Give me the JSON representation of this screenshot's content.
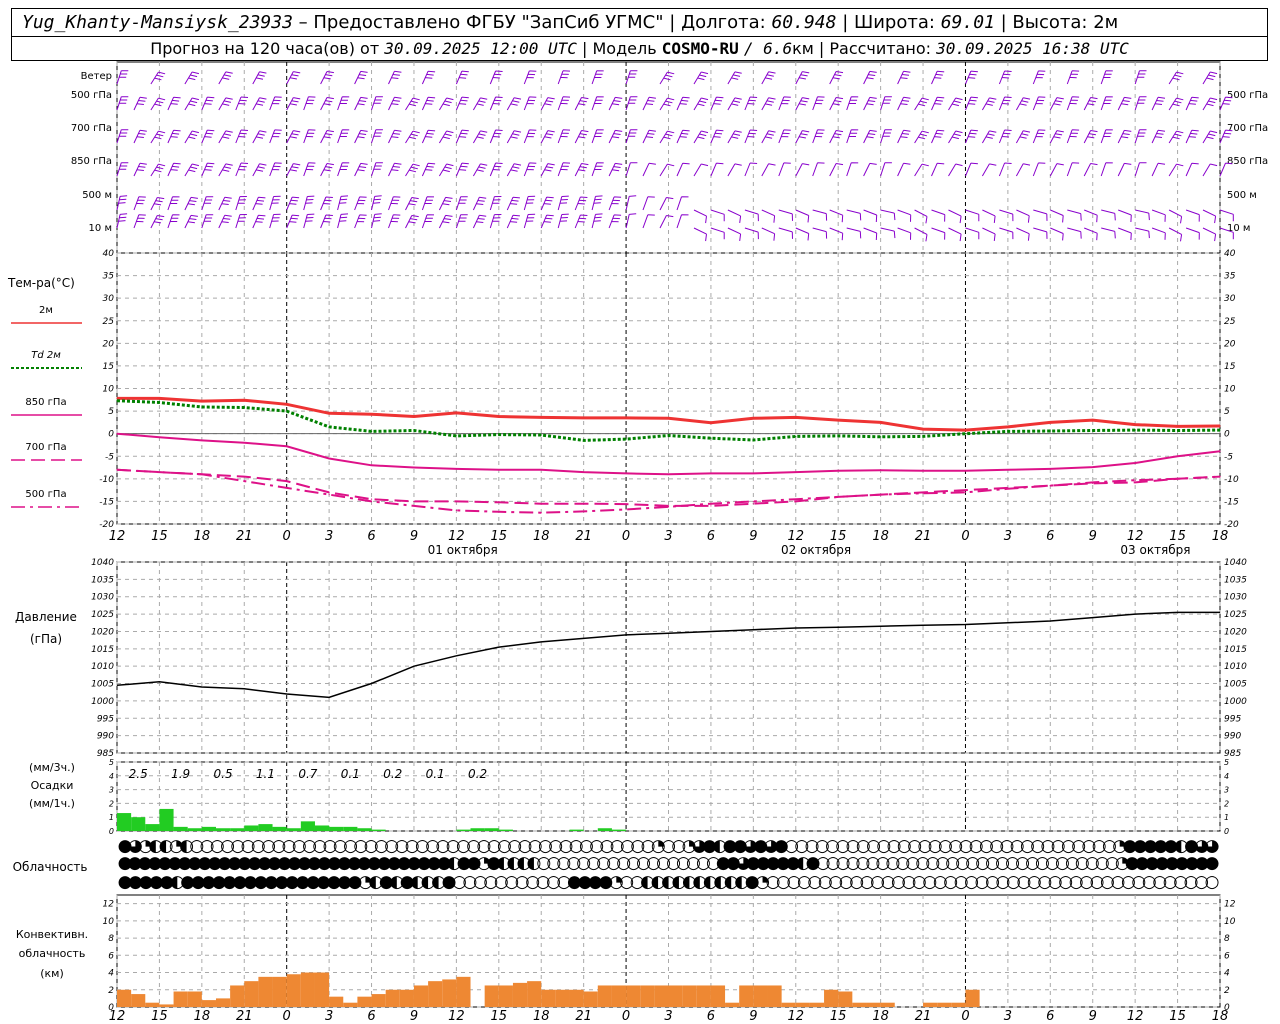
{
  "header": {
    "station": "Yug_Khanty-Mansiysk_23933",
    "provider": "– Предоставлено ФГБУ \"ЗапСиб УГМС\"",
    "lon_label": "| Долгота:",
    "lon_value": "60.948",
    "lat_label": "| Широта:",
    "lat_value": "69.01",
    "alt_label": "| Высота:",
    "alt_value": "2м",
    "forecast_prefix": "Прогноз на 120 часа(ов) от",
    "forecast_time": "30.09.2025 12:00 UTC",
    "model_label": "| Модель",
    "model_name": "COSMO-RU",
    "model_res": "/ 6.6",
    "model_res_unit": "км",
    "calc_label": "| Рассчитано:",
    "calc_time": "30.09.2025 16:38 UTC"
  },
  "wind_panel": {
    "row_labels": [
      "Ветер",
      "500 гПа",
      "700 гПа",
      "850 гПа",
      "500 м",
      "10  м"
    ],
    "right_labels": [
      "500 гПа",
      "700 гПа",
      "850 гПа",
      "500 м",
      "10  м"
    ],
    "barb_color": "#8800cc"
  },
  "temp_panel": {
    "title": "Тем-ра(°С)",
    "legend": [
      {
        "label": "2м",
        "color": "#ee3333",
        "style": "solid"
      },
      {
        "label": "Td  2м",
        "color": "#008000",
        "style": "dotted"
      },
      {
        "label": "850 гПа",
        "color": "#dd1188",
        "style": "solid"
      },
      {
        "label": "700 гПа",
        "color": "#dd1188",
        "style": "dashed"
      },
      {
        "label": "500 гПа",
        "color": "#dd1188",
        "style": "dashdot"
      }
    ]
  },
  "time_axis": {
    "ticks": [
      "12",
      "15",
      "18",
      "21",
      "0",
      "3",
      "6",
      "9",
      "12",
      "15",
      "18",
      "21",
      "0",
      "3",
      "6",
      "9",
      "12",
      "15",
      "18",
      "21",
      "0",
      "3",
      "6",
      "9",
      "12",
      "15",
      "18"
    ],
    "date_labels": [
      "01 октября",
      "02 октября",
      "03 октября"
    ]
  },
  "pressure_panel": {
    "title": "Давление",
    "unit": "(гПа)"
  },
  "precip_panel": {
    "label1": "(мм/3ч.)",
    "label2": "Осадки",
    "label3": "(мм/1ч.)",
    "totals_3h": [
      "2.5",
      "1.9",
      "0.5",
      "1.1",
      "0.7",
      "0.1",
      "0.2",
      "0.1",
      "0.2"
    ],
    "bar_color": "#22cc22"
  },
  "cloud_panel": {
    "label": "Облачность",
    "rows": [
      "●◕◔◐◐◔◐○○○○○○○○○○○○○○○○○○○○○○○○○○○○○○○○○○○○○○○○○○○○○◔○○◔◕●◐●●◕●◕●○○○○○○○○○○○○○○○○○○○○○○○○○○○○○○○○◔●●●●●◐●◕◕",
      "●●●●●●●●●●●●●●●●●●●●●●●●●●●●●●●●●◐●●◔●◐◐◐◐○○○○○○○○○○○○○○○○○○●●◕●●●●●◐●○○○○○○○○○○○○○○○○○○○○○○○○○○○○○○◔●●●●●●●●●",
      "●●●●●◐●●●●●●●●●●●●●●●●●◔◐●◐●◐◐◐●○○○○○○○○○○○●●●●◔○○◐◐◐◐◐◐◐◐◐◐●◔○○○○○○○○○○○○○○○○○○○○○○○○○○○○○○○○○○○○○○○○○○○"
    ]
  },
  "conv_panel": {
    "label1": "Конвективн.",
    "label2": "облачность",
    "label3": "(км)",
    "bar_color": "#ee8833"
  },
  "chart_data": [
    {
      "type": "line",
      "name": "temperature",
      "xlabel": "",
      "ylabel": "Тем-ра(°С)",
      "ylim": [
        -20,
        40
      ],
      "yticks": [
        -20,
        -15,
        -10,
        -5,
        0,
        5,
        10,
        15,
        20,
        25,
        30,
        35,
        40
      ],
      "x_hours": [
        0,
        3,
        6,
        9,
        12,
        15,
        18,
        21,
        24,
        27,
        30,
        33,
        36,
        39,
        42,
        45,
        48,
        51,
        54,
        57,
        60,
        63,
        66,
        69,
        72,
        75,
        78
      ],
      "grid": true,
      "series": [
        {
          "name": "2м",
          "color": "#ee3333",
          "style": "solid",
          "values": [
            7.8,
            7.8,
            7.2,
            7.4,
            6.5,
            4.5,
            4.3,
            3.8,
            4.6,
            3.8,
            3.6,
            3.5,
            3.5,
            3.4,
            2.4,
            3.4,
            3.6,
            3.0,
            2.5,
            1.0,
            0.8,
            1.5,
            2.5,
            3.0,
            2.0,
            1.6,
            1.7
          ]
        },
        {
          "name": "Td  2м",
          "color": "#008000",
          "style": "dotted",
          "values": [
            7.3,
            6.9,
            5.9,
            5.8,
            5.0,
            1.5,
            0.5,
            0.7,
            -0.5,
            -0.2,
            -0.3,
            -1.5,
            -1.2,
            -0.4,
            -1.0,
            -1.4,
            -0.6,
            -0.5,
            -0.7,
            -0.6,
            0.0,
            0.5,
            0.6,
            0.7,
            0.8,
            0.7,
            0.8
          ]
        },
        {
          "name": "850 гПа",
          "color": "#dd1188",
          "style": "solid",
          "values": [
            0.0,
            -0.8,
            -1.5,
            -2.0,
            -2.8,
            -5.5,
            -7.0,
            -7.5,
            -7.8,
            -8.0,
            -8.0,
            -8.5,
            -8.8,
            -9.0,
            -8.8,
            -8.8,
            -8.5,
            -8.2,
            -8.1,
            -8.2,
            -8.2,
            -8.0,
            -7.8,
            -7.4,
            -6.5,
            -5.0,
            -3.9
          ]
        },
        {
          "name": "700 гПа",
          "color": "#dd1188",
          "style": "dashed",
          "values": [
            -8.0,
            -8.5,
            -9.0,
            -9.5,
            -10.5,
            -13.0,
            -14.5,
            -15.0,
            -15.0,
            -15.2,
            -15.5,
            -15.5,
            -15.6,
            -16.0,
            -16.0,
            -15.5,
            -15.0,
            -14.0,
            -13.5,
            -13.0,
            -12.5,
            -12.0,
            -11.5,
            -11.0,
            -10.8,
            -10.0,
            -9.5
          ]
        },
        {
          "name": "500 гПа",
          "color": "#dd1188",
          "style": "dashdot",
          "values": [
            -8.0,
            -8.5,
            -9.0,
            -10.5,
            -12.0,
            -13.5,
            -15.0,
            -16.0,
            -17.0,
            -17.3,
            -17.5,
            -17.2,
            -16.8,
            -16.2,
            -15.5,
            -15.0,
            -14.5,
            -14.0,
            -13.5,
            -13.2,
            -13.0,
            -12.2,
            -11.5,
            -10.8,
            -10.3,
            -10.0,
            -9.5
          ]
        }
      ]
    },
    {
      "type": "line",
      "name": "pressure",
      "ylabel": "Давление",
      "ylim": [
        985,
        1040
      ],
      "yticks": [
        985,
        990,
        995,
        1000,
        1005,
        1010,
        1015,
        1020,
        1025,
        1030,
        1035,
        1040
      ],
      "x_hours": [
        0,
        3,
        6,
        9,
        12,
        15,
        18,
        21,
        24,
        27,
        30,
        33,
        36,
        39,
        42,
        45,
        48,
        51,
        54,
        57,
        60,
        63,
        66,
        69,
        72,
        75,
        78
      ],
      "grid": true,
      "series": [
        {
          "name": "",
          "color": "#000000",
          "values": [
            1004.5,
            1005.5,
            1004.0,
            1003.5,
            1002.0,
            1001.0,
            1005.0,
            1010.0,
            1013.0,
            1015.5,
            1017.0,
            1018.0,
            1019.0,
            1019.5,
            1020.0,
            1020.5,
            1021.0,
            1021.2,
            1021.5,
            1021.8,
            1022.0,
            1022.5,
            1023.0,
            1024.0,
            1025.0,
            1025.5,
            1025.5
          ]
        }
      ]
    },
    {
      "type": "bar",
      "name": "precipitation",
      "ylim": [
        0,
        5
      ],
      "yticks": [
        0,
        1,
        2,
        3,
        4,
        5
      ],
      "x_hours_start": 0,
      "step_hours": 1,
      "values": [
        1.3,
        1.0,
        0.5,
        1.6,
        0.3,
        0.2,
        0.3,
        0.2,
        0.2,
        0.4,
        0.5,
        0.3,
        0.2,
        0.7,
        0.4,
        0.3,
        0.3,
        0.2,
        0.1,
        0.0,
        0.0,
        0.0,
        0.0,
        0.0,
        0.1,
        0.2,
        0.2,
        0.1,
        0.0,
        0.0,
        0.0,
        0.0,
        0.1,
        0.0,
        0.2,
        0.1,
        0.0,
        0.0,
        0.0
      ]
    },
    {
      "type": "bar",
      "name": "convective_cloud",
      "ylim": [
        0,
        13
      ],
      "yticks": [
        0,
        2,
        4,
        6,
        8,
        10,
        12
      ],
      "x_hours_start": 0,
      "step_hours": 1,
      "values": [
        2.0,
        1.5,
        0.5,
        0.3,
        1.8,
        1.8,
        0.8,
        1.0,
        2.5,
        3.0,
        3.5,
        3.5,
        3.8,
        4.0,
        4.0,
        1.2,
        0.5,
        1.2,
        1.5,
        2.0,
        2.0,
        2.5,
        3.0,
        3.2,
        3.5,
        0.0,
        2.5,
        2.5,
        2.8,
        3.0,
        2.0,
        2.0,
        2.0,
        1.8,
        2.5,
        2.5,
        2.5,
        2.5,
        2.5,
        2.5,
        2.5,
        2.5,
        2.5,
        0.5,
        2.5,
        2.5,
        2.5,
        0.5,
        0.5,
        0.5,
        2.0,
        1.8,
        0.5,
        0.5,
        0.5,
        0.0,
        0.0,
        0.5,
        0.5,
        0.5,
        2.0,
        0.0,
        0.0,
        0.0,
        0.0,
        0.0,
        0.0,
        0.0,
        0.0,
        0.0,
        0.0,
        0.0,
        0.0,
        0.0,
        0.0,
        0.0,
        0.0,
        0.0,
        0.0
      ]
    }
  ]
}
